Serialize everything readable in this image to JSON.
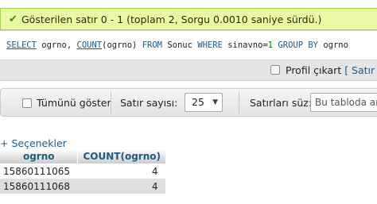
{
  "message": {
    "icon": "success-check-icon",
    "text": "Gösterilen satır 0 - 1 (toplam 2, Sorgu 0.0010 saniye sürdü.)"
  },
  "sql": {
    "select_kw": "SELECT",
    "cols": " ogrno, ",
    "count_fn": "COUNT",
    "count_arg": "(ogrno) ",
    "from_kw": "FROM",
    "table": " Sonuc ",
    "where_kw": "WHERE",
    "cond": " sinavno=",
    "cond_val": "1",
    "group_kw": " GROUP BY",
    "group_col": " ogrno"
  },
  "profile": {
    "label": "Profil çıkart",
    "bracket": " [ ",
    "link": "Satır iç"
  },
  "nav": {
    "show_all_label": "Tümünü göster",
    "rows_label": "Satır sayısı:",
    "rows_value": "25",
    "filter_label": "Satırları süz:",
    "filter_placeholder": "Bu tabloda ara"
  },
  "options_link": "+ Seçenekler",
  "table": {
    "headers": [
      "ogrno",
      "COUNT(ogrno)"
    ],
    "rows": [
      [
        "15860111065",
        "4"
      ],
      [
        "15860111068",
        "4"
      ]
    ]
  }
}
